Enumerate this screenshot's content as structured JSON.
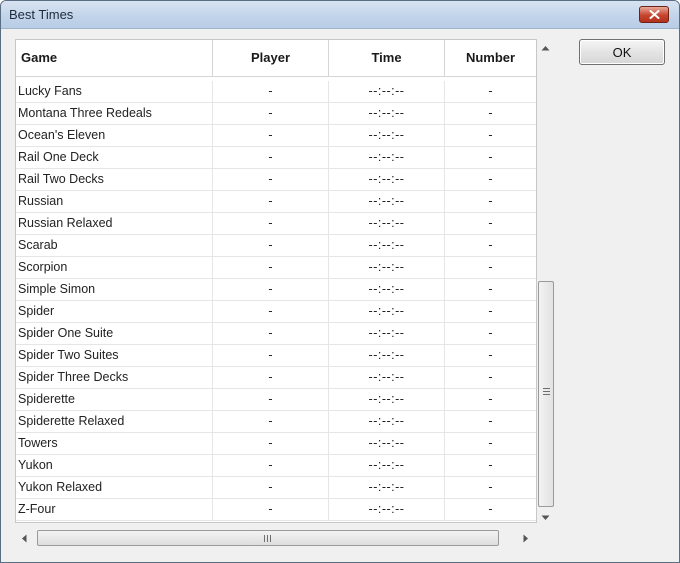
{
  "window": {
    "title": "Best Times"
  },
  "buttons": {
    "ok_label": "OK"
  },
  "table": {
    "columns": [
      "Game",
      "Player",
      "Time",
      "Number"
    ],
    "rows": [
      [
        "Lucky Fans",
        "-",
        "--:--:--",
        "-"
      ],
      [
        "Montana Three Redeals",
        "-",
        "--:--:--",
        "-"
      ],
      [
        "Ocean's Eleven",
        "-",
        "--:--:--",
        "-"
      ],
      [
        "Rail One Deck",
        "-",
        "--:--:--",
        "-"
      ],
      [
        "Rail Two Decks",
        "-",
        "--:--:--",
        "-"
      ],
      [
        "Russian",
        "-",
        "--:--:--",
        "-"
      ],
      [
        "Russian Relaxed",
        "-",
        "--:--:--",
        "-"
      ],
      [
        "Scarab",
        "-",
        "--:--:--",
        "-"
      ],
      [
        "Scorpion",
        "-",
        "--:--:--",
        "-"
      ],
      [
        "Simple Simon",
        "-",
        "--:--:--",
        "-"
      ],
      [
        "Spider",
        "-",
        "--:--:--",
        "-"
      ],
      [
        "Spider One Suite",
        "-",
        "--:--:--",
        "-"
      ],
      [
        "Spider Two Suites",
        "-",
        "--:--:--",
        "-"
      ],
      [
        "Spider Three Decks",
        "-",
        "--:--:--",
        "-"
      ],
      [
        "Spiderette",
        "-",
        "--:--:--",
        "-"
      ],
      [
        "Spiderette Relaxed",
        "-",
        "--:--:--",
        "-"
      ],
      [
        "Towers",
        "-",
        "--:--:--",
        "-"
      ],
      [
        "Yukon",
        "-",
        "--:--:--",
        "-"
      ],
      [
        "Yukon Relaxed",
        "-",
        "--:--:--",
        "-"
      ],
      [
        "Z-Four",
        "-",
        "--:--:--",
        "-"
      ]
    ]
  },
  "icons": {
    "close": "close-icon",
    "scroll_up": "arrow-up-icon",
    "scroll_down": "arrow-down-icon",
    "scroll_left": "arrow-left-icon",
    "scroll_right": "arrow-right-icon"
  },
  "colors": {
    "title_bar": "#c1d3ea",
    "close_button": "#c7452e"
  }
}
